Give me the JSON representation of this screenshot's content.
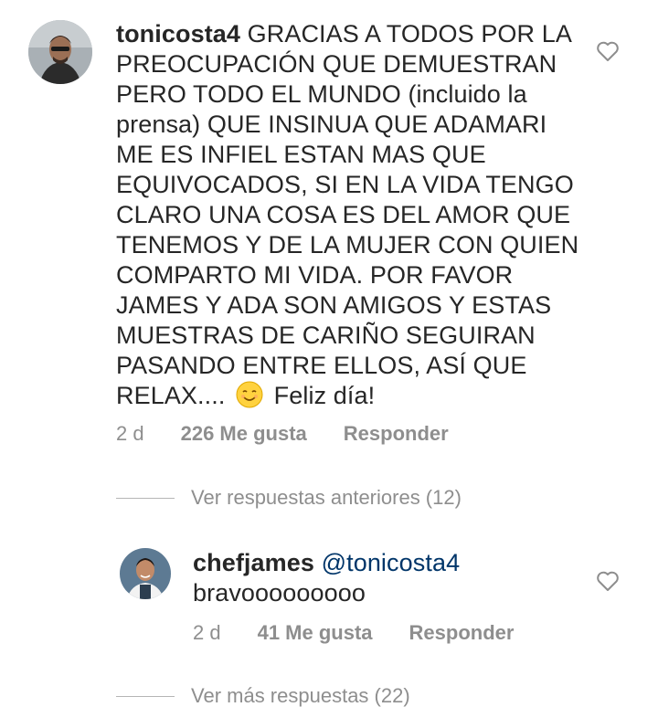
{
  "comments": [
    {
      "username": "tonicosta4",
      "text": "GRACIAS A TODOS POR LA PREOCUPACIÓN QUE DEMUESTRAN PERO TODO EL MUNDO (incluido la prensa) QUE INSINUA QUE ADAMARI ME ES INFIEL ESTAN MAS QUE EQUIVOCADOS, SI EN LA VIDA TENGO CLARO UNA COSA ES DEL AMOR QUE TENEMOS Y DE LA MUJER CON QUIEN COMPARTO MI VIDA. POR FAVOR JAMES Y ADA SON AMIGOS Y ESTAS MUESTRAS DE CARIÑO SEGUIRAN PASANDO ENTRE ELLOS, ASÍ QUE RELAX....",
      "text_lines": [
        "PREOCUPACIÓN QUE DEMUESTRAN",
        "PERO TODO EL MUNDO (incluido la",
        "prensa) QUE INSINUA QUE ADAMARI",
        "ME ES INFIEL ESTAN MAS QUE",
        "EQUIVOCADOS, SI EN LA VIDA TENGO",
        "CLARO UNA COSA ES DEL AMOR QUE",
        "TENEMOS Y DE LA MUJER CON QUIEN",
        "COMPARTO MI VIDA. POR FAVOR",
        "JAMES Y ADA SON AMIGOS Y ESTAS",
        "MUESTRAS DE CARIÑO SEGUIRAN",
        "PASANDO ENTRE ELLOS, ASÍ QUE"
      ],
      "first_line_rest": "GRACIAS A TODOS POR LA",
      "last_line_before_emoji": "RELAX....",
      "emoji": "smiling-face-emoji",
      "last_line_after_emoji": "Feliz día!",
      "time": "2 d",
      "likes": "226 Me gusta",
      "reply": "Responder"
    },
    {
      "username": "chefjames",
      "mention": "@tonicosta4",
      "text": "bravooooooooo",
      "time": "2 d",
      "likes": "41 Me gusta",
      "reply": "Responder"
    }
  ],
  "threads": {
    "previous": "Ver respuestas anteriores (12)",
    "more": "Ver más respuestas (22)"
  },
  "icons": {
    "like": "heart-outline-icon"
  },
  "colors": {
    "text": "#262626",
    "meta": "#8e8e8e",
    "mention": "#003569",
    "line": "#b5b5b5"
  }
}
